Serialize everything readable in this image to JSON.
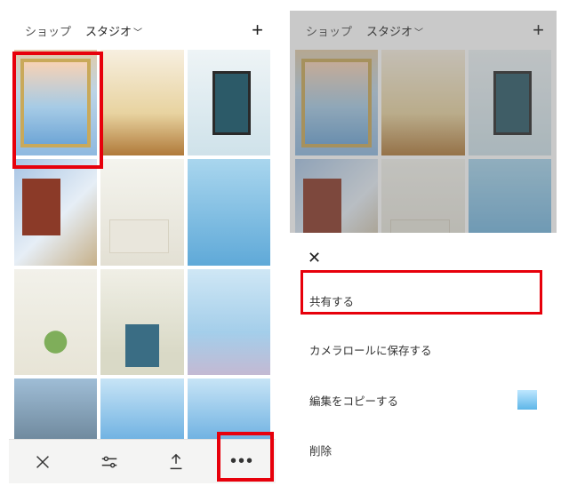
{
  "tabs": {
    "shop": "ショップ",
    "studio": "スタジオ"
  },
  "sheet": {
    "share": "共有する",
    "save_to_camera_roll": "カメラロールに保存する",
    "copy_edit": "編集をコピーする",
    "delete": "削除"
  }
}
